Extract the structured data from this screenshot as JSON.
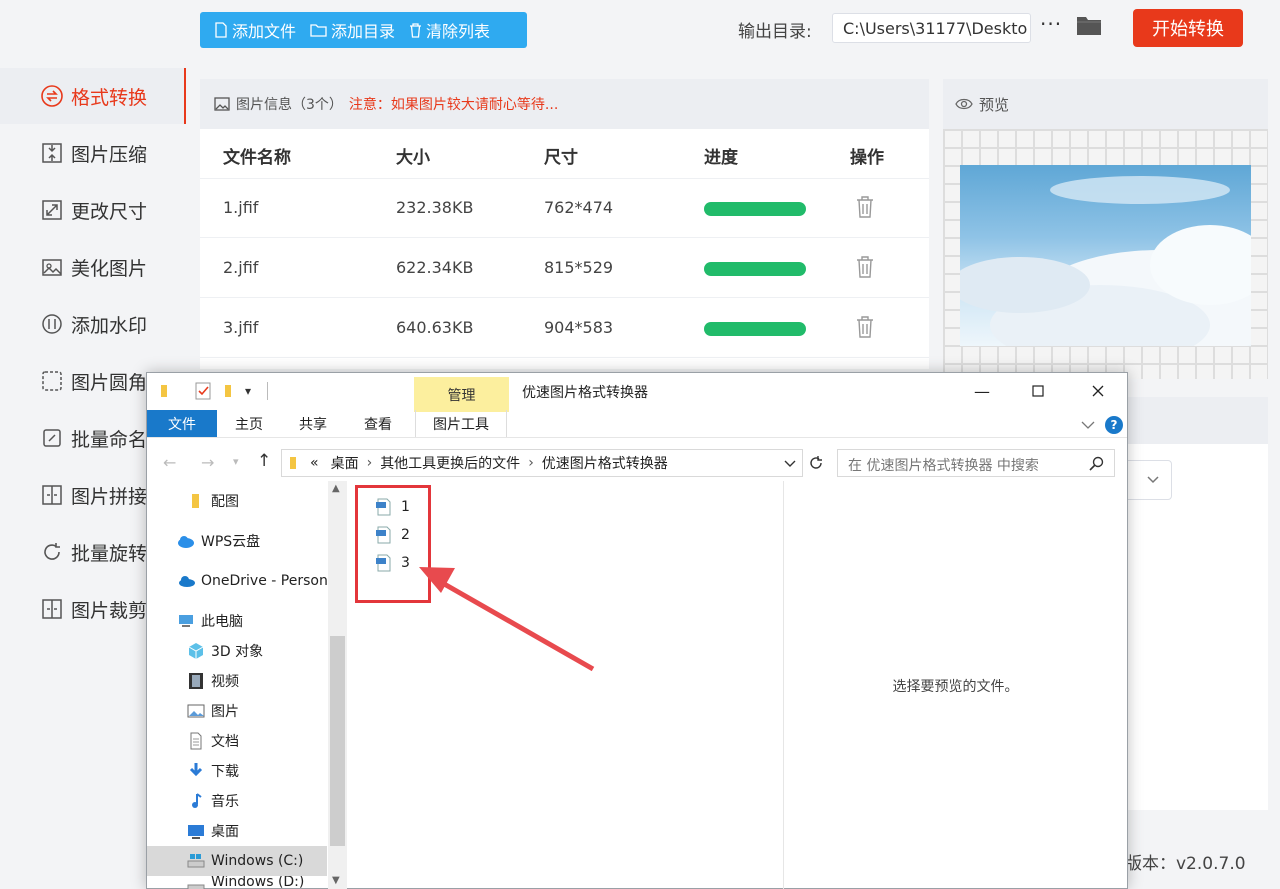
{
  "app": {
    "toolbar": {
      "add_file": "添加文件",
      "add_dir": "添加目录",
      "clear_list": "清除列表"
    },
    "output_label": "输出目录:",
    "output_path": "C:\\Users\\31177\\Deskto",
    "more": "···",
    "start_button": "开始转换",
    "sidebar": [
      {
        "label": "格式转换",
        "icon": "format-convert-icon",
        "active": true
      },
      {
        "label": "图片压缩",
        "icon": "compress-icon"
      },
      {
        "label": "更改尺寸",
        "icon": "resize-icon"
      },
      {
        "label": "美化图片",
        "icon": "beautify-icon"
      },
      {
        "label": "添加水印",
        "icon": "watermark-icon"
      },
      {
        "label": "图片圆角",
        "icon": "round-corner-icon"
      },
      {
        "label": "批量命名",
        "icon": "rename-icon"
      },
      {
        "label": "图片拼接",
        "icon": "stitch-icon"
      },
      {
        "label": "批量旋转",
        "icon": "rotate-icon"
      },
      {
        "label": "图片裁剪",
        "icon": "crop-icon"
      }
    ],
    "info": {
      "title": "图片信息",
      "count": "（3个）",
      "warning": "注意：如果图片较大请耐心等待..."
    },
    "table": {
      "headers": [
        "文件名称",
        "大小",
        "尺寸",
        "进度",
        "操作"
      ],
      "rows": [
        {
          "name": "1.jfif",
          "size": "232.38KB",
          "dims": "762*474",
          "progress": 1.0
        },
        {
          "name": "2.jfif",
          "size": "622.34KB",
          "dims": "815*529",
          "progress": 1.0
        },
        {
          "name": "3.jfif",
          "size": "640.63KB",
          "dims": "904*583",
          "progress": 1.0
        }
      ]
    },
    "preview_label": "预览",
    "version": "；版本：v2.0.7.0",
    "colors": {
      "accent": "#e8391b",
      "toolbar": "#2faaf0",
      "progress": "#21bb6a"
    }
  },
  "explorer": {
    "title": "优速图片格式转换器",
    "manage_tab": "管理",
    "tabs": [
      "文件",
      "主页",
      "共享",
      "查看",
      "图片工具"
    ],
    "breadcrumb": [
      "«",
      "桌面",
      "其他工具更换后的文件",
      "优速图片格式转换器"
    ],
    "search_placeholder": "在 优速图片格式转换器 中搜索",
    "nav": [
      {
        "label": "配图",
        "icon": "folder-icon"
      },
      {
        "label": "WPS云盘",
        "icon": "cloud-icon"
      },
      {
        "label": "OneDrive - Person",
        "icon": "onedrive-icon"
      },
      {
        "label": "此电脑",
        "icon": "computer-icon"
      },
      {
        "label": "3D 对象",
        "icon": "cube-icon"
      },
      {
        "label": "视频",
        "icon": "video-icon"
      },
      {
        "label": "图片",
        "icon": "picture-icon"
      },
      {
        "label": "文档",
        "icon": "document-icon"
      },
      {
        "label": "下载",
        "icon": "download-icon"
      },
      {
        "label": "音乐",
        "icon": "music-icon"
      },
      {
        "label": "桌面",
        "icon": "desktop-icon"
      },
      {
        "label": "Windows (C:)",
        "icon": "drive-icon",
        "selected": true
      },
      {
        "label": "Windows (D:)",
        "icon": "drive-icon"
      }
    ],
    "files": [
      "1",
      "2",
      "3"
    ],
    "detail_text": "选择要预览的文件。"
  }
}
